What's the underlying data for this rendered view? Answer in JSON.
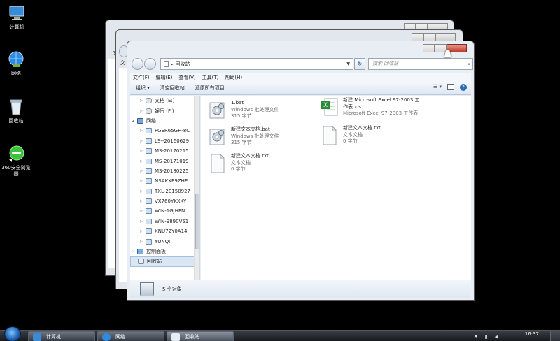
{
  "desktop": {
    "icons": [
      {
        "label": "计算机"
      },
      {
        "label": "网络"
      },
      {
        "label": "回收站"
      },
      {
        "label": "360安全浏览器"
      }
    ]
  },
  "back_windows": {
    "menu_first_letter": "文"
  },
  "explorer": {
    "address": "回收站",
    "search_placeholder": "搜索 回收站",
    "menu": [
      "文件(F)",
      "编辑(E)",
      "查看(V)",
      "工具(T)",
      "帮助(H)"
    ],
    "toolbar": {
      "organize": "组织 ▾",
      "empty_bin": "清空回收站",
      "restore_all": "还原所有项目"
    },
    "tree": [
      {
        "label": "文档 (E:)",
        "type": "drive",
        "indent": 1
      },
      {
        "label": "娱乐 (F:)",
        "type": "drive",
        "indent": 1
      },
      {
        "label": "网络",
        "type": "network",
        "indent": 0
      },
      {
        "label": "FGER65GH-8C",
        "type": "pc",
        "indent": 1
      },
      {
        "label": "LS--20160629",
        "type": "pc",
        "indent": 1
      },
      {
        "label": "MS-20170215",
        "type": "pc",
        "indent": 1
      },
      {
        "label": "MS-20171019",
        "type": "pc",
        "indent": 1
      },
      {
        "label": "MS-20180225",
        "type": "pc",
        "indent": 1
      },
      {
        "label": "NSAKXE9ZHE",
        "type": "pc",
        "indent": 1
      },
      {
        "label": "TXL-20150927",
        "type": "pc",
        "indent": 1
      },
      {
        "label": "VX760YKXKY",
        "type": "pc",
        "indent": 1
      },
      {
        "label": "WIN-1GJHFN",
        "type": "pc",
        "indent": 1
      },
      {
        "label": "WIN-9890V51",
        "type": "pc",
        "indent": 1
      },
      {
        "label": "XNU72Y0A14",
        "type": "pc",
        "indent": 1
      },
      {
        "label": "YUNQI",
        "type": "pc",
        "indent": 1
      },
      {
        "label": "控制面板",
        "type": "control",
        "indent": 0
      },
      {
        "label": "回收站",
        "type": "recycle",
        "indent": 0,
        "selected": true
      }
    ],
    "files": [
      {
        "name": "1.bat",
        "type": "Windows 批处理文件",
        "size": "315 字节",
        "icon": "bat-icon"
      },
      {
        "name": "新建 Microsoft Excel 97-2003 工",
        "name2": "作表.xls",
        "type": "Microsoft Excel 97-2003 工作表",
        "size": "",
        "icon": "excel-icon"
      },
      {
        "name": "新建文本文档.bat",
        "type": "Windows 批处理文件",
        "size": "315 字节",
        "icon": "bat-icon"
      },
      {
        "name": "新建文本文档.txt",
        "type": "文本文档",
        "size": "0 字节",
        "icon": "txt-icon"
      },
      {
        "name": "新建文本文档.txt",
        "type": "文本文档",
        "size": "0 字节",
        "icon": "txt-icon"
      }
    ],
    "status": "5 个对象"
  },
  "taskbar": {
    "tasks": [
      "计算机",
      "网络",
      "回收站"
    ],
    "time": "16:37"
  },
  "colors": {
    "desktop": "#000000",
    "accent": "#2a6ab0",
    "close_button": "#c0392b"
  }
}
